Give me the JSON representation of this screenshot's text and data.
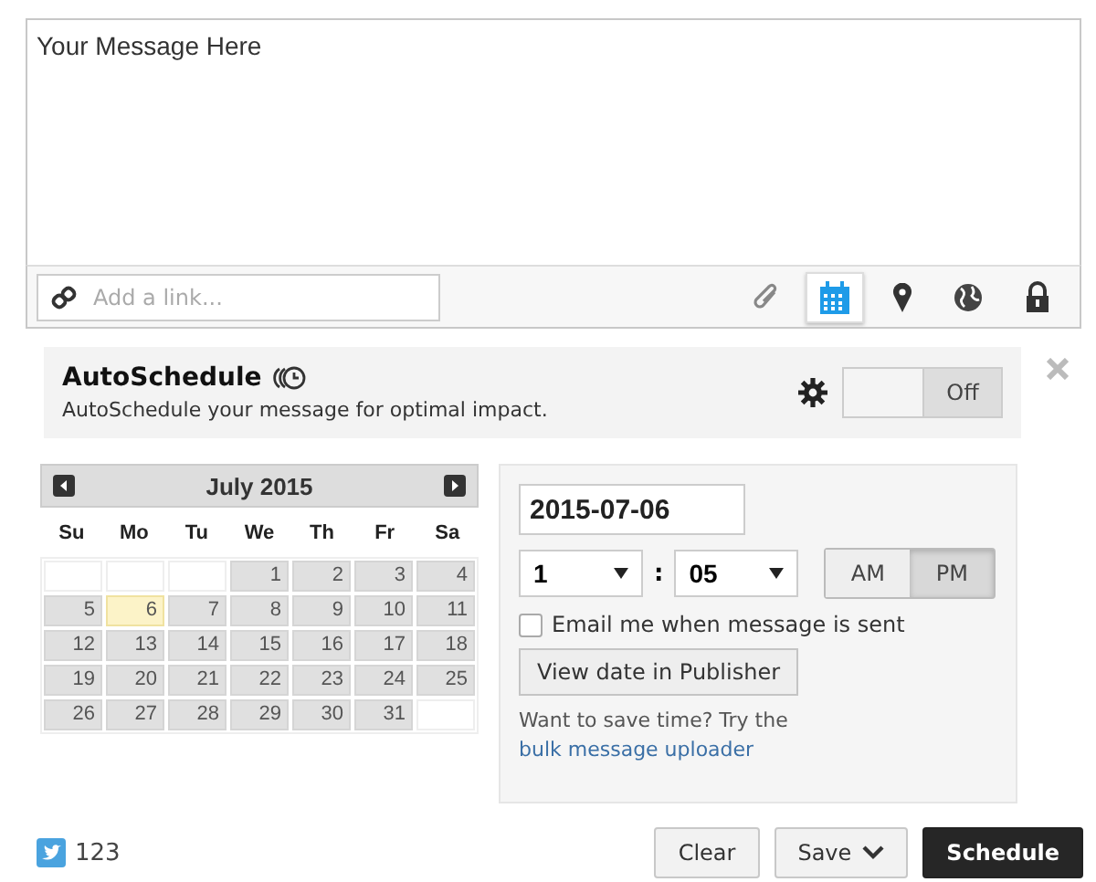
{
  "composer": {
    "message": "Your Message Here",
    "link_placeholder": "Add a link...",
    "tools": [
      {
        "kind": "attach",
        "selected": false
      },
      {
        "kind": "calendar",
        "selected": true
      },
      {
        "kind": "location",
        "selected": false
      },
      {
        "kind": "globe",
        "selected": false
      },
      {
        "kind": "lock",
        "selected": false
      }
    ]
  },
  "autoschedule": {
    "title": "AutoSchedule",
    "description": "AutoSchedule your message for optimal impact.",
    "on": false,
    "toggle_label": "Off"
  },
  "calendar": {
    "month": "July 2015",
    "weekdays": [
      "Su",
      "Mo",
      "Tu",
      "We",
      "Th",
      "Fr",
      "Sa"
    ],
    "weeks": [
      [
        {
          "kind": "blank"
        },
        {
          "kind": "blank"
        },
        {
          "kind": "blank"
        },
        {
          "kind": "day",
          "day": "1",
          "selected": false
        },
        {
          "kind": "day",
          "day": "2",
          "selected": false
        },
        {
          "kind": "day",
          "day": "3",
          "selected": false
        },
        {
          "kind": "day",
          "day": "4",
          "selected": false
        }
      ],
      [
        {
          "kind": "day",
          "day": "5",
          "selected": false
        },
        {
          "kind": "day",
          "day": "6",
          "selected": true
        },
        {
          "kind": "day",
          "day": "7",
          "selected": false
        },
        {
          "kind": "day",
          "day": "8",
          "selected": false
        },
        {
          "kind": "day",
          "day": "9",
          "selected": false
        },
        {
          "kind": "day",
          "day": "10",
          "selected": false
        },
        {
          "kind": "day",
          "day": "11",
          "selected": false
        }
      ],
      [
        {
          "kind": "day",
          "day": "12",
          "selected": false
        },
        {
          "kind": "day",
          "day": "13",
          "selected": false
        },
        {
          "kind": "day",
          "day": "14",
          "selected": false
        },
        {
          "kind": "day",
          "day": "15",
          "selected": false
        },
        {
          "kind": "day",
          "day": "16",
          "selected": false
        },
        {
          "kind": "day",
          "day": "17",
          "selected": false
        },
        {
          "kind": "day",
          "day": "18",
          "selected": false
        }
      ],
      [
        {
          "kind": "day",
          "day": "19",
          "selected": false
        },
        {
          "kind": "day",
          "day": "20",
          "selected": false
        },
        {
          "kind": "day",
          "day": "21",
          "selected": false
        },
        {
          "kind": "day",
          "day": "22",
          "selected": false
        },
        {
          "kind": "day",
          "day": "23",
          "selected": false
        },
        {
          "kind": "day",
          "day": "24",
          "selected": false
        },
        {
          "kind": "day",
          "day": "25",
          "selected": false
        }
      ],
      [
        {
          "kind": "day",
          "day": "26",
          "selected": false
        },
        {
          "kind": "day",
          "day": "27",
          "selected": false
        },
        {
          "kind": "day",
          "day": "28",
          "selected": false
        },
        {
          "kind": "day",
          "day": "29",
          "selected": false
        },
        {
          "kind": "day",
          "day": "30",
          "selected": false
        },
        {
          "kind": "day",
          "day": "31",
          "selected": false
        },
        {
          "kind": "blank"
        }
      ]
    ]
  },
  "time": {
    "date": "2015-07-06",
    "hour": "1",
    "separator": ":",
    "minute": "05",
    "meridiem": [
      {
        "label": "AM",
        "selected": false
      },
      {
        "label": "PM",
        "selected": true
      }
    ],
    "email_label": "Email me when message is sent",
    "email_checked": false,
    "view_button": "View date in Publisher",
    "tip": "Want to save time? Try the",
    "tip_link": "bulk message uploader"
  },
  "footer": {
    "count": "123",
    "buttons": [
      {
        "kind": "plain",
        "label": "Clear"
      },
      {
        "kind": "dropdown",
        "label": "Save"
      },
      {
        "kind": "primary",
        "label": "Schedule"
      }
    ]
  }
}
